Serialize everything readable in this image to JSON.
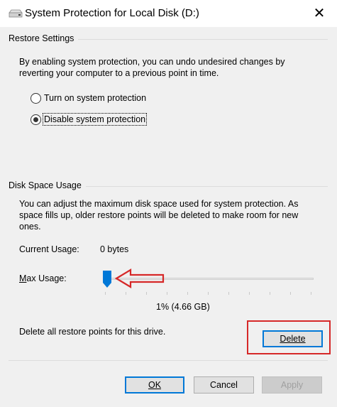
{
  "window": {
    "title": "System Protection for Local Disk (D:)",
    "close_glyph": "✕"
  },
  "restore_settings": {
    "heading": "Restore Settings",
    "description_line1": "By enabling system protection, you can undo undesired changes by",
    "description_line2": "reverting your computer to a previous point in time.",
    "option_on": "Turn on system protection",
    "option_off": "Disable system protection",
    "selected": "option_off"
  },
  "disk_space": {
    "heading": "Disk Space Usage",
    "description_line1": "You can adjust the maximum disk space used for system protection. As",
    "description_line2": "space fills up, older restore points will be deleted to make room for new",
    "description_line3": "ones.",
    "current_usage_label": "Current Usage:",
    "current_usage_value": "0 bytes",
    "max_usage_label_pre": "M",
    "max_usage_label_post": "ax Usage:",
    "max_usage_value": "1% (4.66 GB)",
    "max_usage_fraction": 0.01,
    "delete_text": "Delete all restore points for this drive.",
    "delete_button": "Delete"
  },
  "footer": {
    "ok_button": "OK",
    "cancel_button": "Cancel",
    "apply_button": "Apply"
  },
  "colors": {
    "accent": "#0078d7",
    "annotation": "#d62828"
  },
  "icons": {
    "title": "drive-icon",
    "close": "close-icon",
    "annotation": "red-arrow-icon"
  }
}
